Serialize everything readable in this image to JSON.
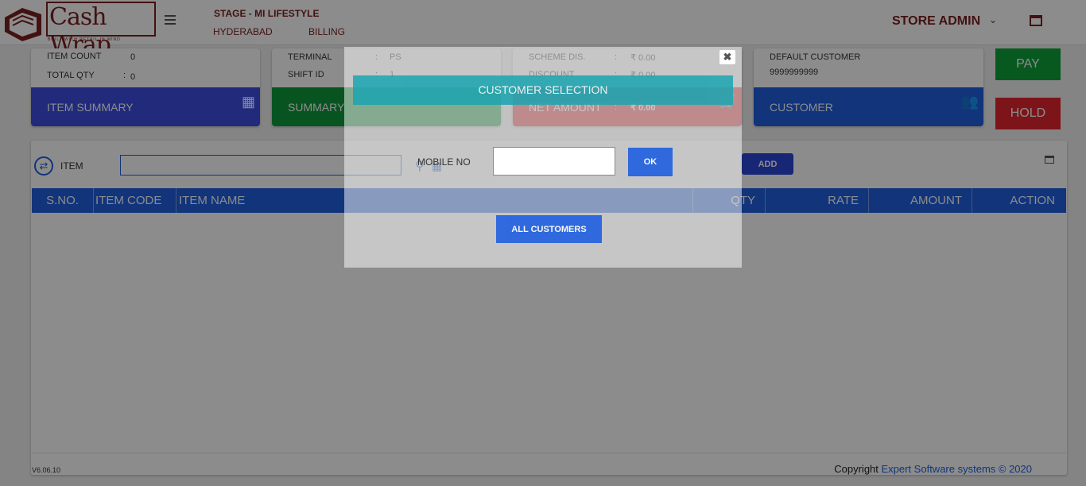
{
  "header": {
    "logo_text": "Cash Wrap",
    "logo_tagline": "BUILT WITH RETAIL IN MIND",
    "store_name": "STAGE - MI LIFESTYLE",
    "location": "HYDERABAD",
    "module": "BILLING",
    "user": "STORE ADMIN"
  },
  "cards": {
    "item_summary": {
      "item_count_label": "ITEM COUNT",
      "item_count_value": "0",
      "total_qty_label": "TOTAL QTY",
      "total_qty_sep": ":",
      "total_qty_value": "0",
      "band_label": "ITEM SUMMARY"
    },
    "summary": {
      "terminal_label": "TERMINAL",
      "terminal_sep": ":",
      "terminal_value": "PS",
      "shift_label": "SHIFT ID",
      "shift_sep": ":",
      "shift_value": "1",
      "band_label": "SUMMARY"
    },
    "amount": {
      "scheme_label": "SCHEME DIS.",
      "scheme_sep": ":",
      "scheme_value": "₹ 0.00",
      "discount_label": "DISCOUNT",
      "discount_sep": ":",
      "discount_value": "₹ 0.00",
      "net_label": "NET AMOUNT",
      "net_sep": ":",
      "net_value": "₹ 0.00"
    },
    "customer": {
      "name": "DEFAULT CUSTOMER",
      "phone": "9999999999",
      "band_label": "CUSTOMER"
    }
  },
  "actions": {
    "pay": "PAY",
    "hold": "HOLD"
  },
  "item_panel": {
    "item_label": "ITEM",
    "add_label": "ADD",
    "columns": [
      "S.NO.",
      "ITEM CODE",
      "ITEM NAME",
      "QTY",
      "RATE",
      "AMOUNT",
      "ACTION"
    ],
    "version": "V6.06.10",
    "copyright_prefix": "Copyright ",
    "copyright_link": "Expert Software systems © 2020"
  },
  "modal": {
    "title": "CUSTOMER SELECTION",
    "mobile_label": "MOBILE NO",
    "mobile_value": "",
    "ok_label": "OK",
    "all_customers_label": "ALL CUSTOMERS"
  },
  "colors": {
    "brand": "#7a1f1f",
    "blue": "#1f5fe0",
    "green": "#109a3c",
    "red": "#e3262e",
    "indigo": "#3d4de0",
    "teal": "#1aa5b0"
  }
}
